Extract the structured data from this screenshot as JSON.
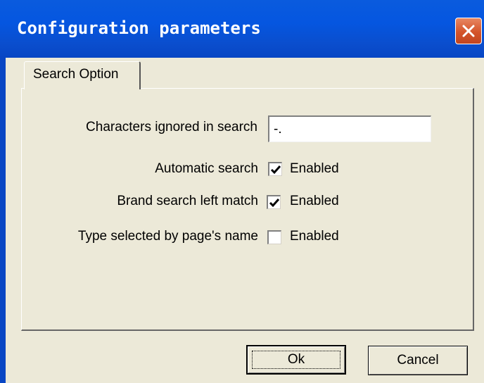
{
  "window": {
    "title": "Configuration parameters",
    "close_icon": "close-icon"
  },
  "tabs": [
    {
      "label": "Search Option",
      "selected": true
    }
  ],
  "form": {
    "ignored_chars": {
      "label": "Characters ignored in search",
      "value": "-."
    },
    "options": [
      {
        "label": "Automatic search",
        "checkbox_label": "Enabled",
        "checked": true
      },
      {
        "label": "Brand search left match",
        "checkbox_label": "Enabled",
        "checked": true
      },
      {
        "label": "Type selected by page's name",
        "checkbox_label": "Enabled",
        "checked": false
      }
    ]
  },
  "buttons": {
    "ok": "Ok",
    "cancel": "Cancel"
  },
  "colors": {
    "titlebar": "#0556E0",
    "dialog_bg": "#ECE9D8",
    "close_button": "#D4542A"
  }
}
